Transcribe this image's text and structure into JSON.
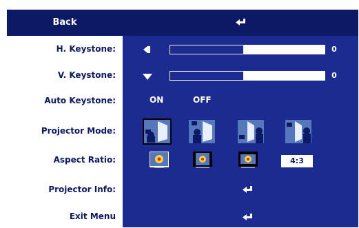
{
  "menu": {
    "back_label": "Back",
    "rows": {
      "h_keystone": {
        "label": "H. Keystone:",
        "value": "0",
        "slider_fill_fraction": 0.475
      },
      "v_keystone": {
        "label": "V. Keystone:",
        "value": "0",
        "slider_fill_fraction": 0.475
      },
      "auto_keystone": {
        "label": "Auto Keystone:",
        "on_label": "ON",
        "off_label": "OFF",
        "selected": "ON"
      },
      "projector_mode": {
        "label": "Projector Mode:",
        "selected_index": 0
      },
      "aspect_ratio": {
        "label": "Aspect Ratio:",
        "option_4_3": "4:3",
        "selected_index": 0
      },
      "projector_info": {
        "label": "Projector Info:"
      },
      "exit_menu": {
        "label": "Exit Menu"
      }
    }
  },
  "icons": {
    "back": "enter-arrow-icon",
    "projector_info": "enter-arrow-icon",
    "exit_menu": "enter-arrow-icon"
  },
  "colors": {
    "panel_dark": "#0c1a66",
    "panel": "#1b2b8f",
    "label_text": "#0c1a66",
    "icon_blue": "#5578bd"
  }
}
